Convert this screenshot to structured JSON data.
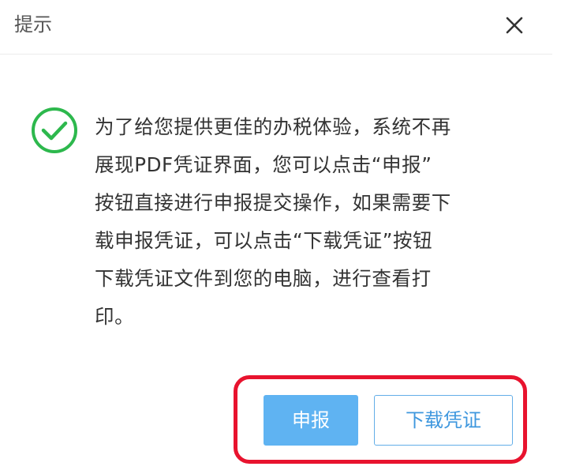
{
  "dialog": {
    "title": "提示",
    "close_icon": "close-icon",
    "status_icon": "check-circle-icon",
    "status_color": "#2db84d",
    "message": "为了给您提供更佳的办税体验，系统不再\n展现PDF凭证界面，您可以点击“申报”\n按钮直接进行申报提交操作，如果需要下\n载申报凭证，可以点击“下载凭证”按钮\n下载凭证文件到您的电脑，进行查看打\n印。",
    "buttons": {
      "declare_label": "申报",
      "download_label": "下载凭证"
    },
    "highlight_color": "#e8132e",
    "primary_color": "#5fb3f2"
  }
}
